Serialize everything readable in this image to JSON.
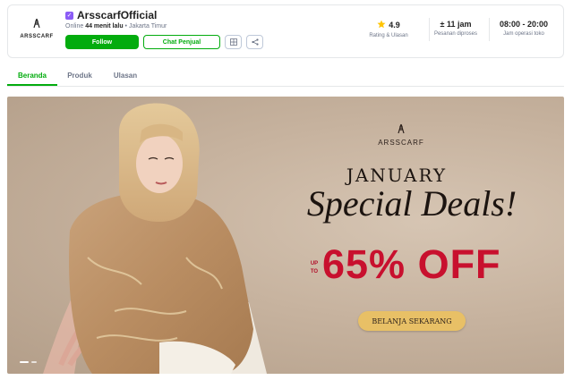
{
  "shop": {
    "logo_text": "ARSSCARF",
    "name": "ArsscarfOfficial",
    "status_prefix": "Online",
    "status_time": "44 menit lalu",
    "status_location": "• Jakarta Timur",
    "follow_label": "Follow",
    "chat_label": "Chat Penjual"
  },
  "stats": [
    {
      "value": "4.9",
      "label": "Rating & Ulasan",
      "icon": "star-icon"
    },
    {
      "value": "± 11 jam",
      "label": "Pesanan diproses"
    },
    {
      "value": "08:00 - 20:00",
      "label": "Jam operasi toko"
    }
  ],
  "tabs": [
    {
      "label": "Beranda",
      "active": true
    },
    {
      "label": "Produk",
      "active": false
    },
    {
      "label": "Ulasan",
      "active": false
    }
  ],
  "banner": {
    "brand": "ARSSCARF",
    "headline": "JANUARY",
    "script": "Special Deals!",
    "upto": "UP TO",
    "discount": "65% OFF",
    "cta": "BELANJA SEKARANG"
  },
  "colors": {
    "primary": "#03ac0e",
    "star": "#ffc400",
    "discount": "#c8102e",
    "cta": "#e8c066",
    "badge": "#8b5cf6"
  }
}
